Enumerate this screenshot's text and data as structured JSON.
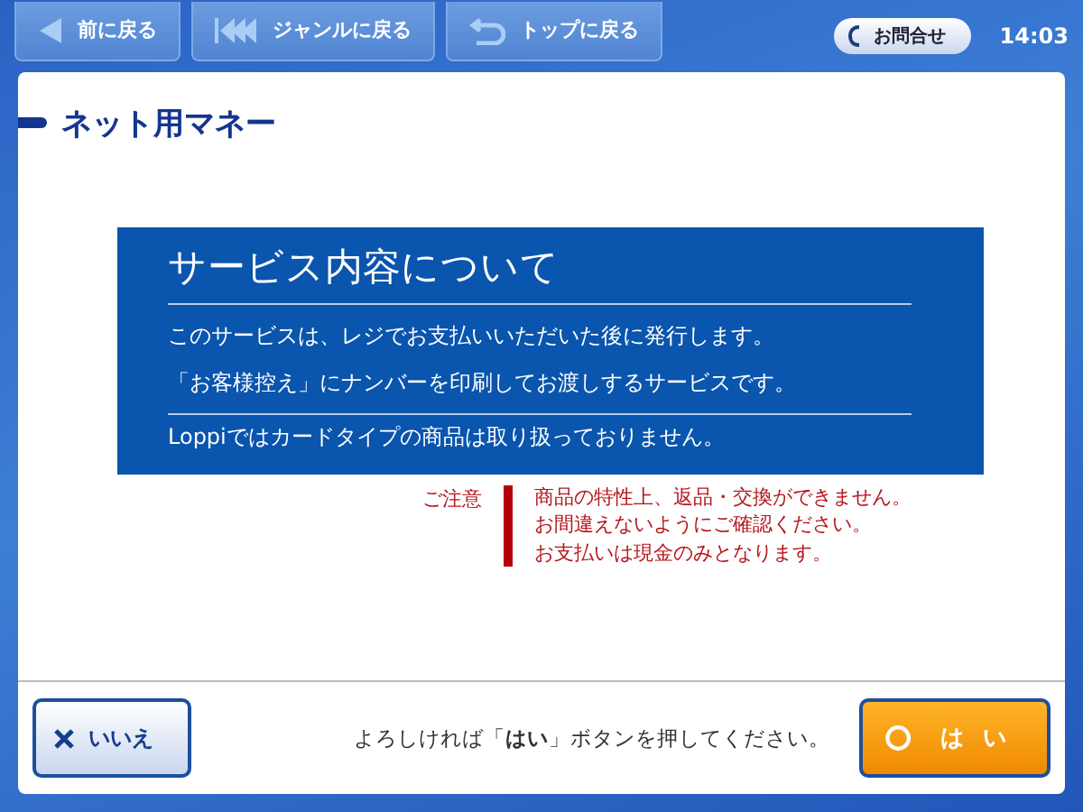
{
  "top_bar": {
    "nav_buttons": [
      {
        "kind": "back",
        "label": "前に戻る"
      },
      {
        "kind": "genre",
        "label": "ジャンルに戻る"
      },
      {
        "kind": "top",
        "label": "トップに戻る"
      }
    ],
    "contact_button": "お問合せ",
    "time": "14:03"
  },
  "page_title": "ネット用マネー",
  "info_box": {
    "title": "サービス内容について",
    "lines": [
      "このサービスは、レジでお支払いいただいた後に発行します。",
      "「お客様控え」にナンバーを印刷してお渡しするサービスです。"
    ],
    "note": "Loppiではカードタイプの商品は取り扱っておりません。"
  },
  "caution": {
    "label": "ご注意",
    "lines": [
      "商品の特性上、返品・交換ができません。",
      "お間違えないようにご確認ください。",
      "お支払いは現金のみとなります。"
    ]
  },
  "footer": {
    "no_button": "いいえ",
    "prompt": "よろしければ「**はい**」ボタンを押してください。",
    "yes_button": "はい"
  }
}
